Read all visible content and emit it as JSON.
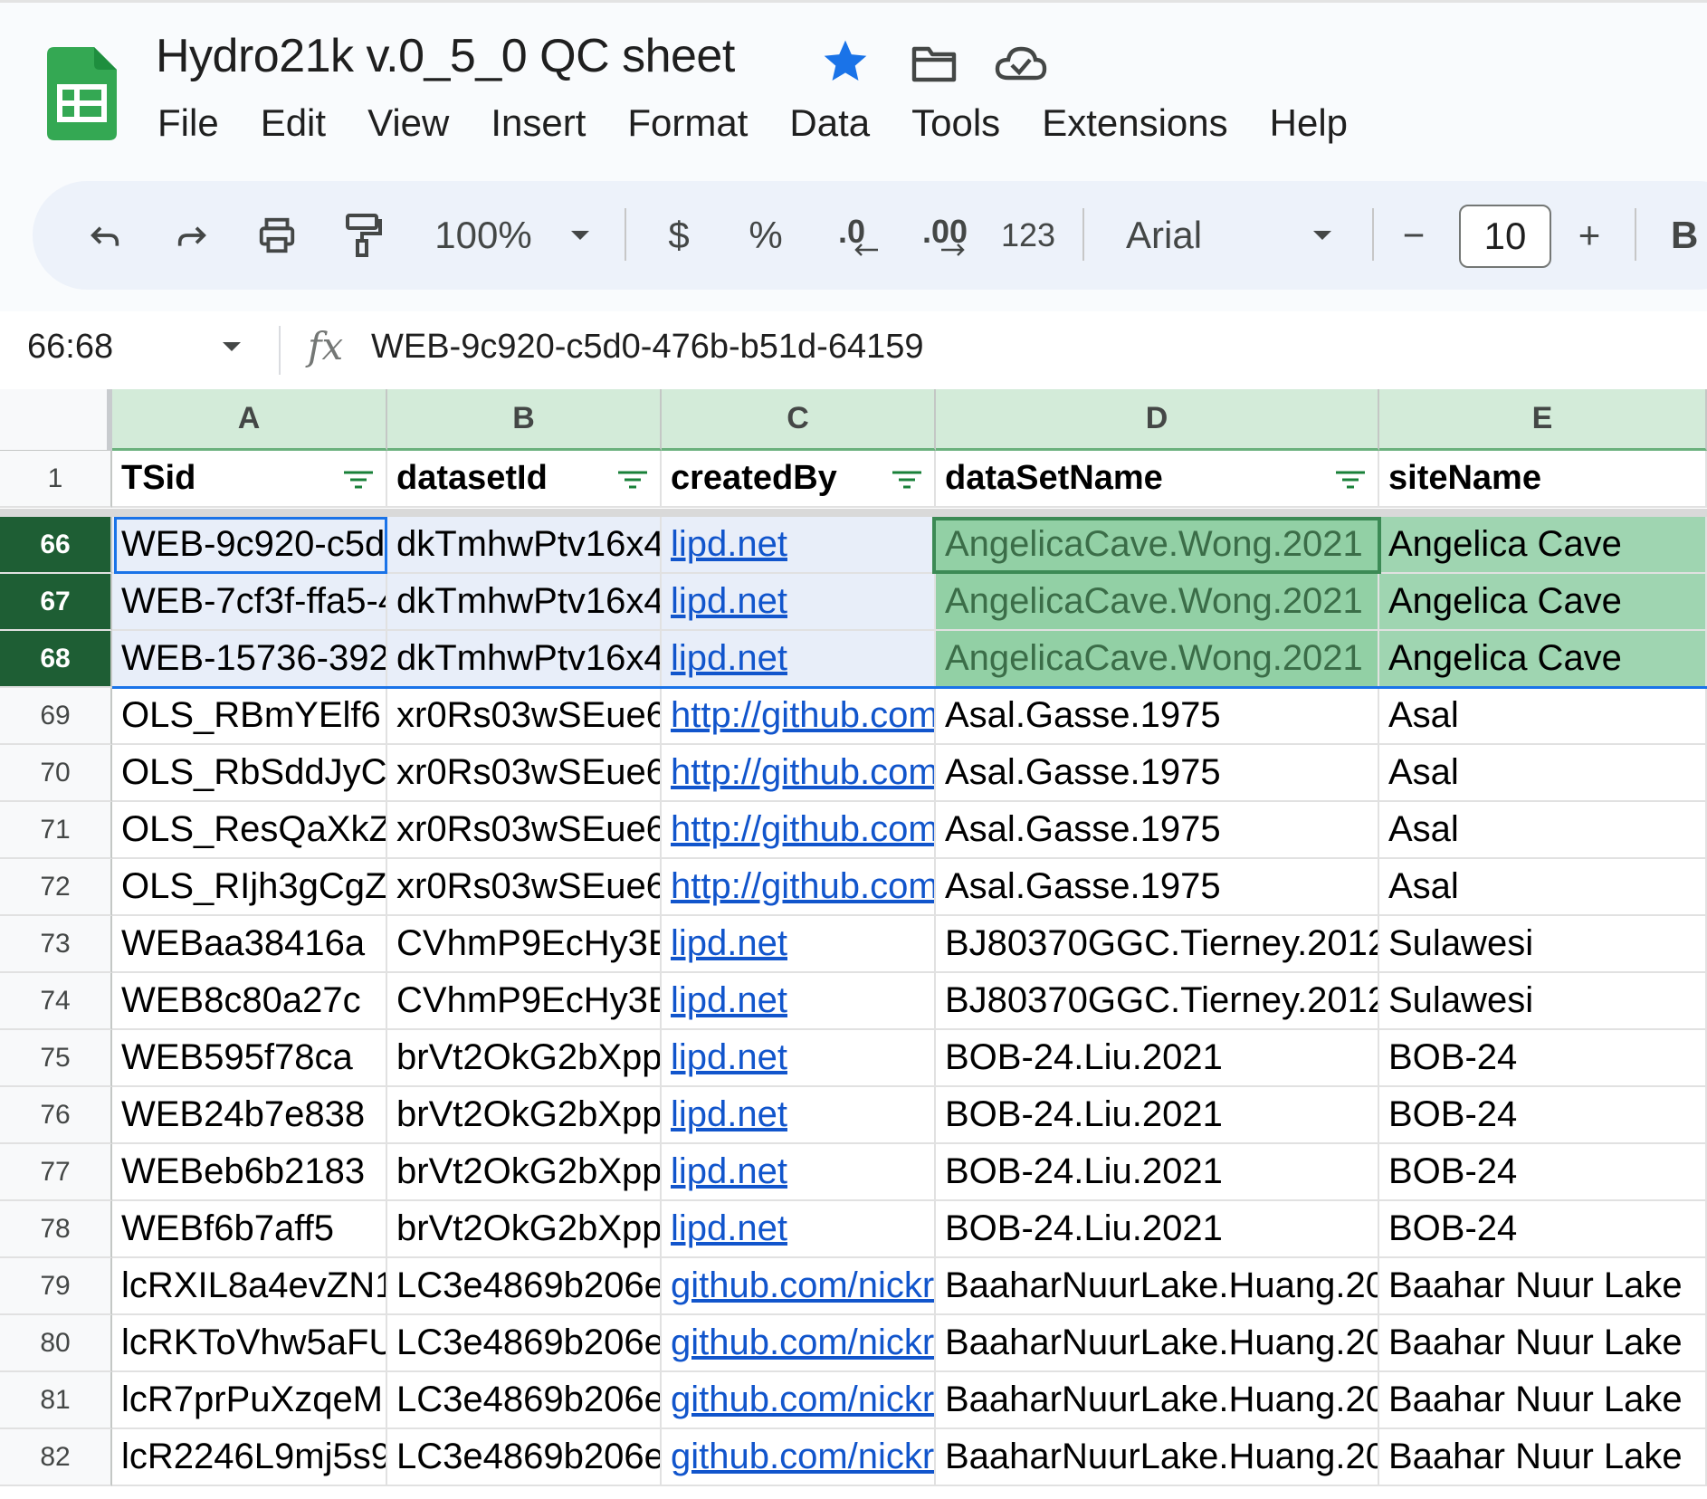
{
  "app": {
    "title": "Hydro21k v.0_5_0 QC sheet",
    "icons": [
      "sheets-logo-icon",
      "star-icon",
      "folder-icon",
      "cloud-saved-icon"
    ],
    "accent_color": "#1a73e8",
    "header_green": "#d3ebd9",
    "selected_row_header": "#1e5e34"
  },
  "menu": [
    "File",
    "Edit",
    "View",
    "Insert",
    "Format",
    "Data",
    "Tools",
    "Extensions",
    "Help"
  ],
  "toolbar": {
    "zoom": "100%",
    "currency": "$",
    "percent": "%",
    "decrease_decimal": ".0",
    "increase_decimal": ".00",
    "more_formats": "123",
    "font": "Arial",
    "minus": "−",
    "font_size": "10",
    "plus": "+",
    "bold": "B"
  },
  "formula_bar": {
    "name_box": "66:68",
    "fx": "fx",
    "value": "WEB-9c920-c5d0-476b-b51d-64159"
  },
  "grid": {
    "columns": [
      "A",
      "B",
      "C",
      "D",
      "E"
    ],
    "header_row": {
      "num": "1",
      "cells": [
        "TSid",
        "datasetId",
        "createdBy",
        "dataSetName",
        "siteName"
      ]
    },
    "rows": [
      {
        "num": "66",
        "cells": [
          "WEB-9c920-c5d0-476b-b51d-64159",
          "dkTmhwPtv16x4",
          "lipd.net",
          "AngelicaCave.Wong.2021",
          "Angelica Cave"
        ]
      },
      {
        "num": "67",
        "cells": [
          "WEB-7cf3f-ffa5-4",
          "dkTmhwPtv16x4",
          "lipd.net",
          "AngelicaCave.Wong.2021",
          "Angelica Cave"
        ]
      },
      {
        "num": "68",
        "cells": [
          "WEB-15736-392",
          "dkTmhwPtv16x4",
          "lipd.net",
          "AngelicaCave.Wong.2021",
          "Angelica Cave"
        ]
      },
      {
        "num": "69",
        "cells": [
          "OLS_RBmYElf6",
          "xr0Rs03wSEue6",
          "http://github.com",
          "Asal.Gasse.1975",
          "Asal"
        ]
      },
      {
        "num": "70",
        "cells": [
          "OLS_RbSddJyC",
          "xr0Rs03wSEue6",
          "http://github.com",
          "Asal.Gasse.1975",
          "Asal"
        ]
      },
      {
        "num": "71",
        "cells": [
          "OLS_ResQaXkZ",
          "xr0Rs03wSEue6",
          "http://github.com",
          "Asal.Gasse.1975",
          "Asal"
        ]
      },
      {
        "num": "72",
        "cells": [
          "OLS_RIjh3gCgZ",
          "xr0Rs03wSEue6",
          "http://github.com",
          "Asal.Gasse.1975",
          "Asal"
        ]
      },
      {
        "num": "73",
        "cells": [
          "WEBaa38416a",
          "CVhmP9EcHy3E",
          "lipd.net",
          "BJ80370GGC.Tierney.2012",
          "Sulawesi"
        ]
      },
      {
        "num": "74",
        "cells": [
          "WEB8c80a27c",
          "CVhmP9EcHy3E",
          "lipd.net",
          "BJ80370GGC.Tierney.2012",
          "Sulawesi"
        ]
      },
      {
        "num": "75",
        "cells": [
          "WEB595f78ca",
          "brVt2OkG2bXpp",
          "lipd.net",
          "BOB-24.Liu.2021",
          "BOB-24"
        ]
      },
      {
        "num": "76",
        "cells": [
          "WEB24b7e838",
          "brVt2OkG2bXpp",
          "lipd.net",
          "BOB-24.Liu.2021",
          "BOB-24"
        ]
      },
      {
        "num": "77",
        "cells": [
          "WEBeb6b2183",
          "brVt2OkG2bXpp",
          "lipd.net",
          "BOB-24.Liu.2021",
          "BOB-24"
        ]
      },
      {
        "num": "78",
        "cells": [
          "WEBf6b7aff5",
          "brVt2OkG2bXpp",
          "lipd.net",
          "BOB-24.Liu.2021",
          "BOB-24"
        ]
      },
      {
        "num": "79",
        "cells": [
          "lcRXIL8a4evZN1",
          "LC3e4869b206e",
          "github.com/nickr",
          "BaaharNuurLake.Huang.20",
          "Baahar Nuur Lake"
        ]
      },
      {
        "num": "80",
        "cells": [
          "lcRKToVhw5aFU",
          "LC3e4869b206e",
          "github.com/nickr",
          "BaaharNuurLake.Huang.20",
          "Baahar Nuur Lake"
        ]
      },
      {
        "num": "81",
        "cells": [
          "lcR7prPuXzqeM",
          "LC3e4869b206e",
          "github.com/nickr",
          "BaaharNuurLake.Huang.20",
          "Baahar Nuur Lake"
        ]
      },
      {
        "num": "82",
        "cells": [
          "lcR2246L9mj5s9",
          "LC3e4869b206e",
          "github.com/nickr",
          "BaaharNuurLake.Huang.20",
          "Baahar Nuur Lake"
        ]
      }
    ],
    "selected_rows": [
      "66",
      "67",
      "68"
    ],
    "active_cell": "A66"
  }
}
